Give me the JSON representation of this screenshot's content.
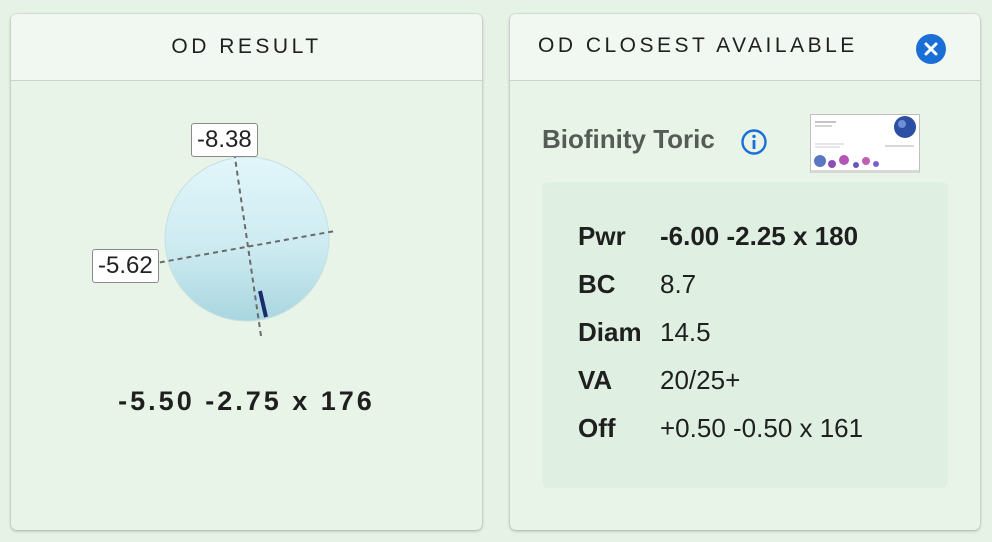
{
  "left_card": {
    "title": "OD RESULT",
    "lens": {
      "top_tag": "-8.38",
      "left_tag": "-5.62"
    },
    "result": "-5.50 -2.75 x 176"
  },
  "right_card": {
    "title": "OD CLOSEST AVAILABLE",
    "close_icon": "close-icon",
    "product_name": "Biofinity Toric",
    "info_icon": "info-icon",
    "rows": [
      {
        "label": "Pwr",
        "value": "-6.00 -2.25 x 180"
      },
      {
        "label": "BC",
        "value": "8.7"
      },
      {
        "label": "Diam",
        "value": "14.5"
      },
      {
        "label": "VA",
        "value": "20/25+"
      },
      {
        "label": "Off",
        "value": "+0.50 -0.50 x 161"
      }
    ]
  },
  "colors": {
    "background": "#e6f2e6",
    "accent": "#1a6fd6",
    "lens_light": "#dff4f8",
    "lens_dark": "#b4dde6"
  }
}
